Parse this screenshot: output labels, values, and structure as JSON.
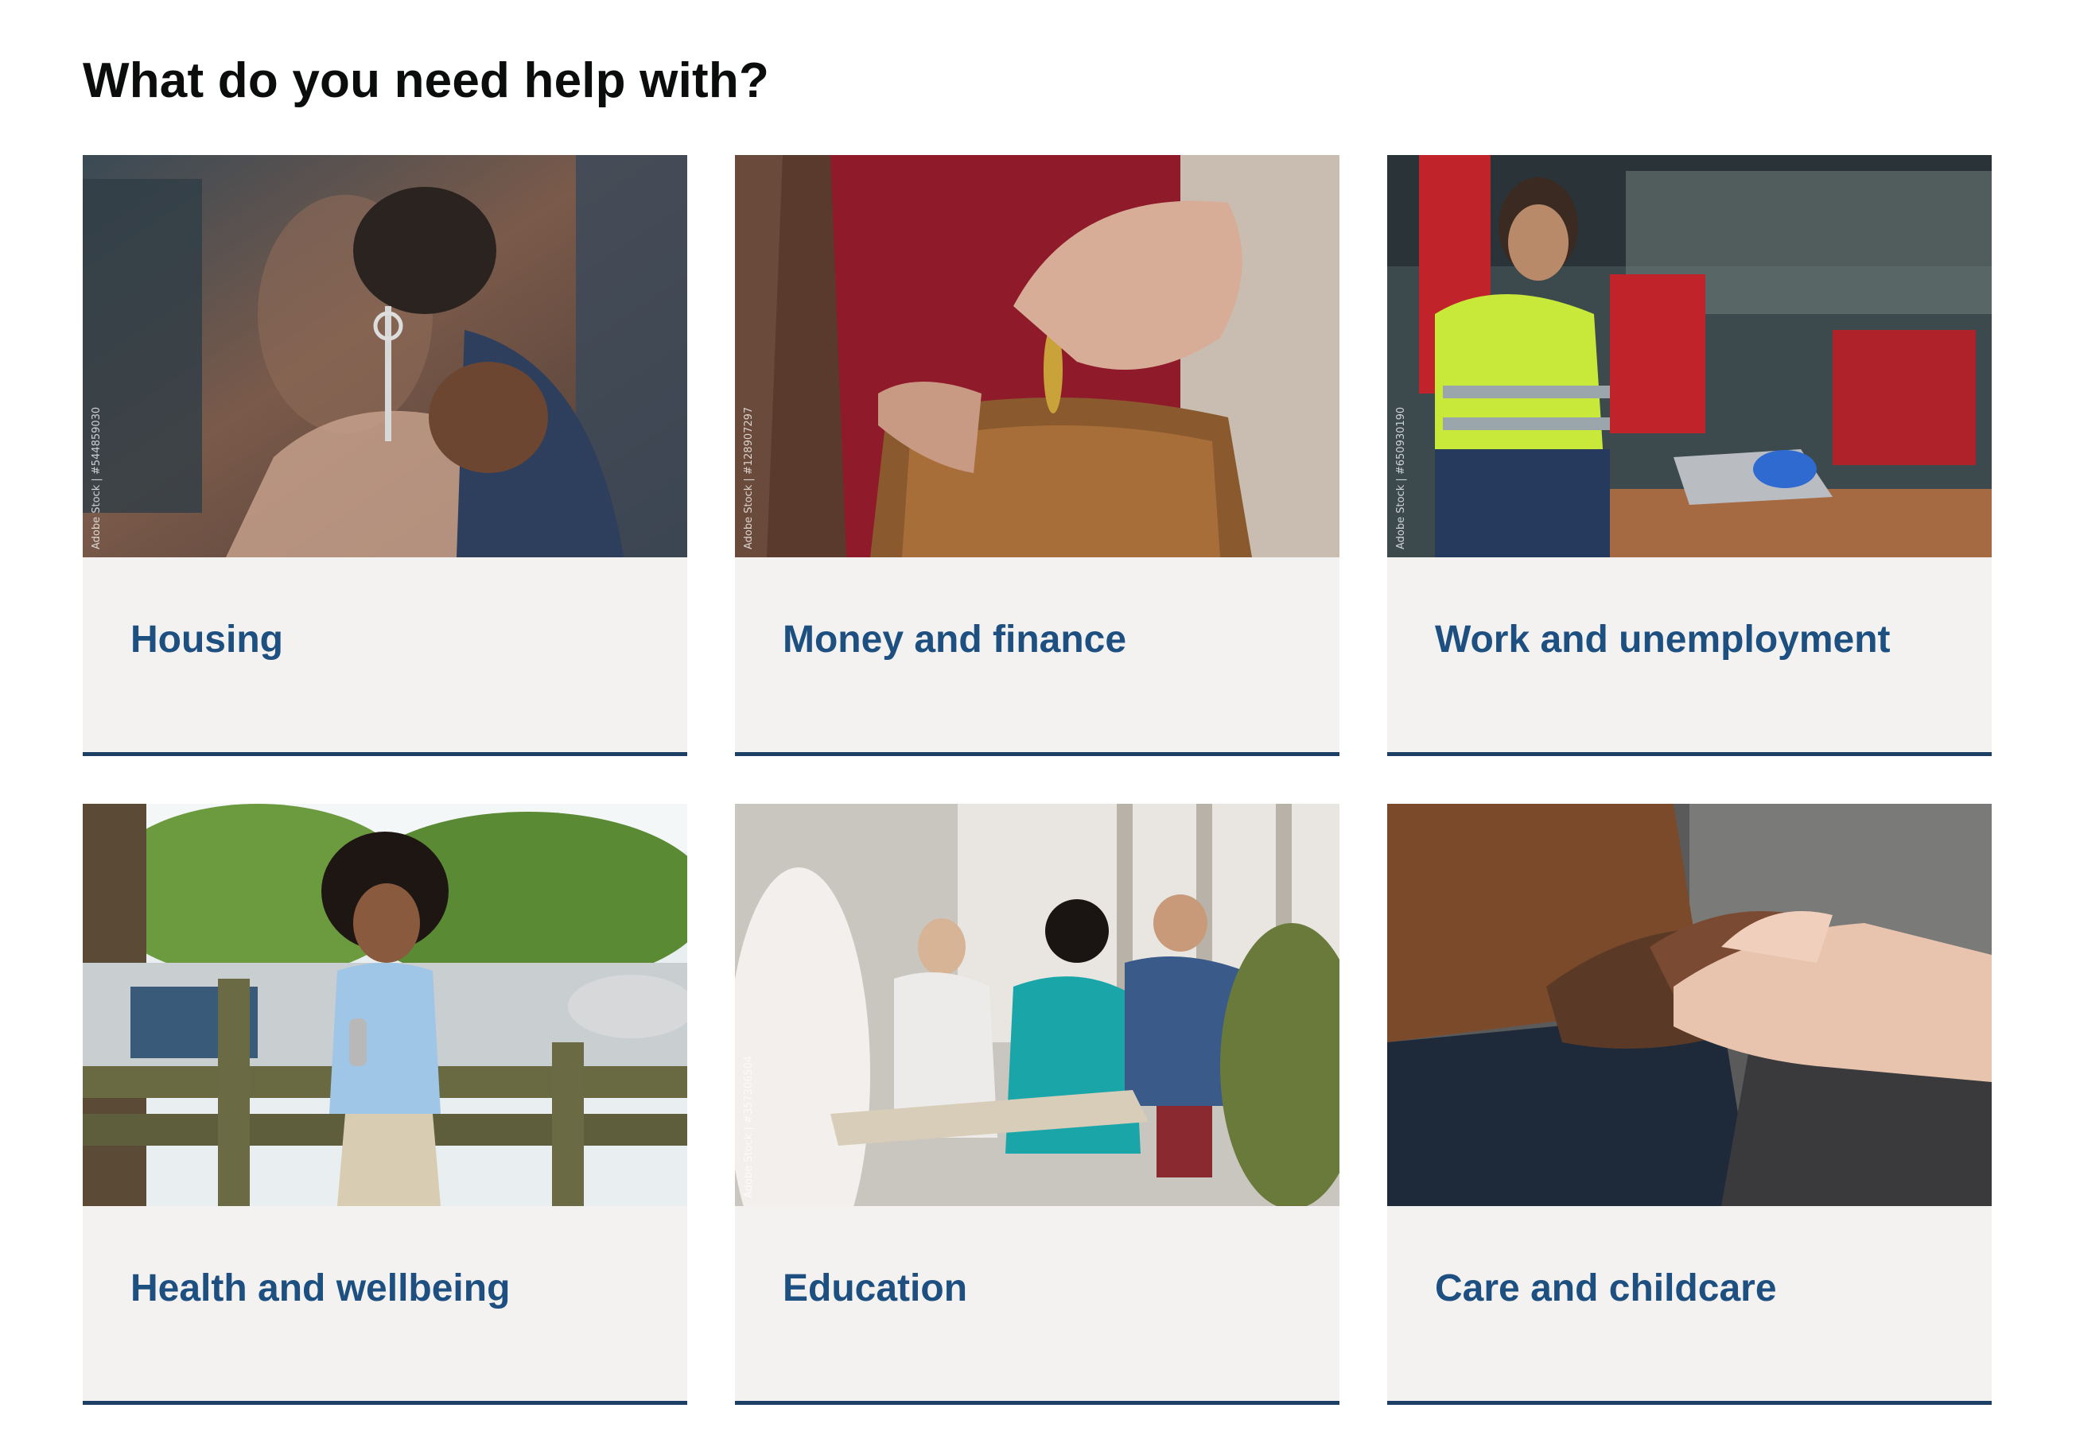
{
  "heading": "What do you need help with?",
  "colors": {
    "link": "#1d4f80",
    "underline": "#1d3f63",
    "panel_bg": "#f3f2f1",
    "heading": "#0b0c0c"
  },
  "cards": [
    {
      "label": "Housing",
      "image": "people-with-house-keys-photo",
      "credit": "Adobe Stock | #544859030"
    },
    {
      "label": "Money and finance",
      "image": "coin-into-purse-photo",
      "credit": "Adobe Stock | #128907297"
    },
    {
      "label": "Work and unemployment",
      "image": "worker-in-hi-vis-at-laptop-photo",
      "credit": "Adobe Stock | #650930190"
    },
    {
      "label": "Health and wellbeing",
      "image": "woman-leaning-on-fence-photo",
      "credit": ""
    },
    {
      "label": "Education",
      "image": "students-in-classroom-photo",
      "credit": "Adobe Stock | #357306504"
    },
    {
      "label": "Care and childcare",
      "image": "holding-hands-photo",
      "credit": ""
    }
  ]
}
